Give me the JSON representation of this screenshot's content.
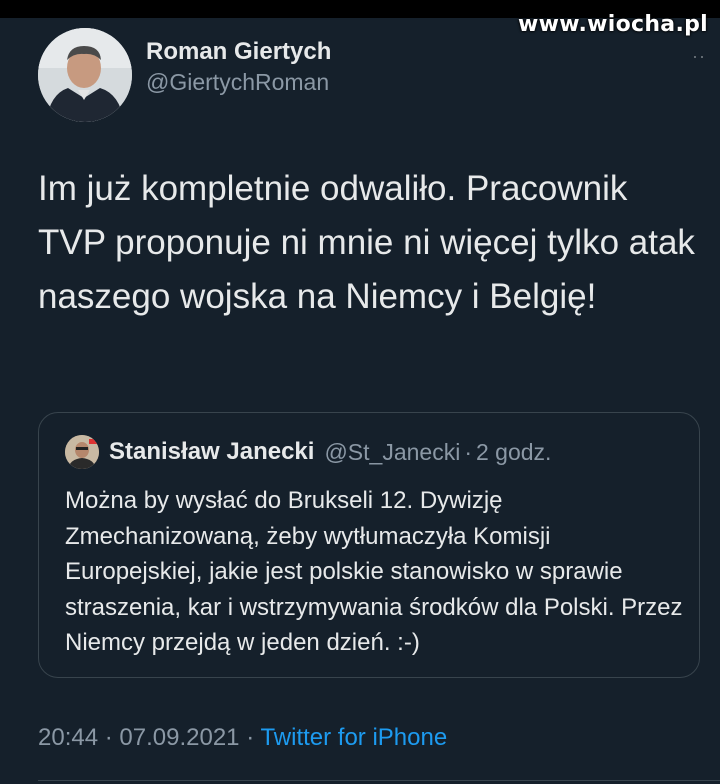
{
  "watermark": "www.wiocha.pl",
  "more_menu": "··",
  "author": {
    "display_name": "Roman Giertych",
    "handle": "@GiertychRoman"
  },
  "tweet_text": "Im już kompletnie odwaliło. Pracownik TVP proponuje ni mnie ni więcej tylko atak naszego wojska na Niemcy i Belgię!",
  "quoted_tweet": {
    "display_name": "Stanisław Janecki",
    "handle": "@St_Janecki",
    "separator": "·",
    "time": "2 godz.",
    "text": "Można by wysłać do Brukseli 12. Dywizję Zmechanizowaną, żeby wytłumaczyła Komisji Europejskiej, jakie jest polskie stanowisko w sprawie straszenia, kar i wstrzymywania środków dla Polski. Przez Niemcy przejdą w jeden dzień. :-)"
  },
  "footer": {
    "time": "20:44",
    "separator1": "·",
    "date": "07.09.2021",
    "separator2": "·",
    "source": "Twitter for iPhone"
  },
  "colors": {
    "background": "#15202b",
    "primary_text": "#e7e9ea",
    "secondary_text": "#8b98a5",
    "link": "#1d9bf0",
    "border": "#38444d"
  }
}
